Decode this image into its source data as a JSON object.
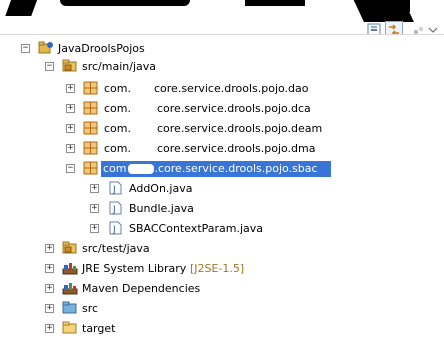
{
  "colors": {
    "selection": "#3875d7",
    "package_icon": "#d28a2c",
    "jar_icon": "#8b5a2b",
    "decoration_text": "#a2752a"
  },
  "toolbar": {
    "icons": [
      "collapse-all-icon",
      "link-with-editor-icon",
      "view-menu-icon",
      "dropdown-icon"
    ]
  },
  "tree": {
    "project": {
      "label": "JavaDroolsPojos"
    },
    "src_main": {
      "label": "src/main/java"
    },
    "packages": [
      {
        "prefix": "com.",
        "suffix": "core.service.drools.pojo.dao"
      },
      {
        "prefix": "com.",
        "suffix": "core.service.drools.pojo.dca"
      },
      {
        "prefix": "com.",
        "suffix": "core.service.drools.pojo.deam"
      },
      {
        "prefix": "com.",
        "suffix": "core.service.drools.pojo.dma"
      }
    ],
    "selected_package": {
      "prefix": "com",
      "suffix": ".core.service.drools.pojo.sbac"
    },
    "files": [
      {
        "label": "AddOn.java"
      },
      {
        "label": "Bundle.java"
      },
      {
        "label": "SBACContextParam.java"
      }
    ],
    "src_test": {
      "label": "src/test/java"
    },
    "jre": {
      "label": "JRE System Library",
      "decoration": "[J2SE-1.5]"
    },
    "maven": {
      "label": "Maven Dependencies"
    },
    "src": {
      "label": "src"
    },
    "target": {
      "label": "target"
    }
  }
}
